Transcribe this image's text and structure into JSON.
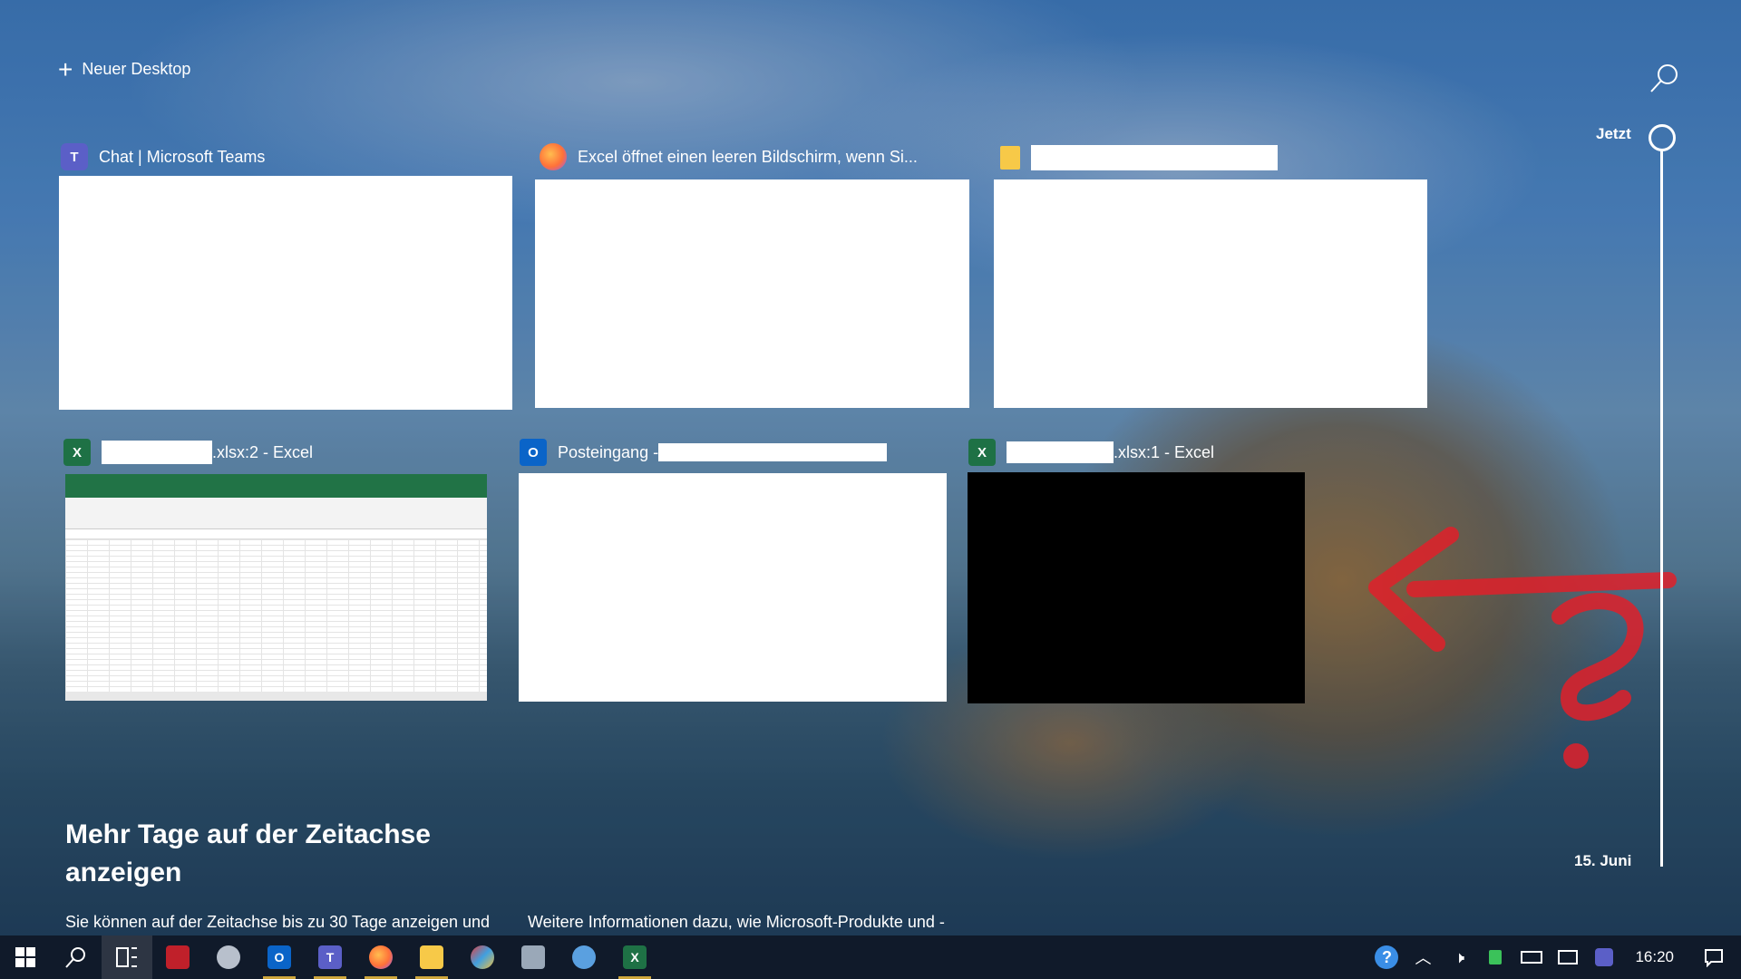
{
  "toolbar": {
    "new_desktop_label": "Neuer Desktop",
    "search_icon": "search-icon"
  },
  "windows": [
    {
      "title": "Chat | Microsoft Teams",
      "icon": "teams-icon"
    },
    {
      "title": "Excel öffnet einen leeren Bildschirm, wenn Si...",
      "icon": "firefox-icon"
    },
    {
      "title": "",
      "icon": "folder-icon"
    },
    {
      "title_suffix": ".xlsx:2 - Excel",
      "icon": "excel-icon"
    },
    {
      "title_prefix": "Posteingang - ",
      "icon": "outlook-icon"
    },
    {
      "title_suffix": ".xlsx:1 - Excel",
      "icon": "excel-icon"
    }
  ],
  "timeline": {
    "now_label": "Jetzt",
    "date_label": "15. Juni"
  },
  "promo": {
    "title": "Mehr Tage auf der Zeitachse anzeigen",
    "text_left": "Sie können auf der Zeitachse bis zu 30 Tage anzeigen und",
    "text_right": "Weitere Informationen dazu, wie Microsoft-Produkte und -"
  },
  "taskbar": {
    "clock": "16:20",
    "apps": [
      "start",
      "search",
      "task-view",
      "app-red",
      "app-shield",
      "outlook",
      "teams",
      "firefox",
      "explorer",
      "paint",
      "app-network",
      "app-remote",
      "excel"
    ]
  },
  "colors": {
    "taskbar_bg": "#101a2a",
    "annotation_red": "#e0202a",
    "excel_green": "#1e7145"
  }
}
